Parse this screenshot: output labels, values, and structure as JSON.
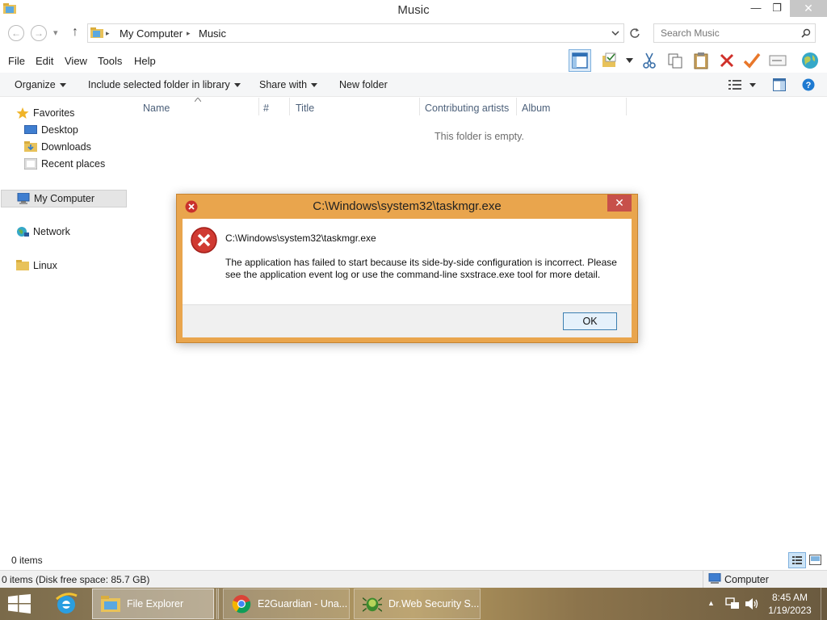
{
  "window": {
    "title": "Music",
    "minimize_glyph": "—",
    "restore_glyph": "❐",
    "close_glyph": "✕"
  },
  "navigation": {
    "back_glyph": "←",
    "forward_glyph": "→",
    "recent_glyph": "▾",
    "up_glyph": "↑"
  },
  "address": {
    "crumbs": [
      "My Computer",
      "Music"
    ],
    "separator": "▸"
  },
  "search": {
    "placeholder": "Search Music"
  },
  "menu": {
    "items": [
      "File",
      "Edit",
      "View",
      "Tools",
      "Help"
    ]
  },
  "toolbar_icons": [
    "layout-icon",
    "folder-check-icon",
    "cut-icon",
    "copy-icon",
    "paste-icon",
    "delete-icon",
    "checkmark-icon",
    "properties-icon",
    "globe-icon"
  ],
  "commandbar": {
    "organize": "Organize",
    "include_library": "Include selected folder in library",
    "share_with": "Share with",
    "new_folder": "New folder"
  },
  "navpane": {
    "favorites": "Favorites",
    "desktop": "Desktop",
    "downloads": "Downloads",
    "recent_places": "Recent places",
    "my_computer": "My Computer",
    "network": "Network",
    "linux": "Linux"
  },
  "columns": [
    "Name",
    "#",
    "Title",
    "Contributing artists",
    "Album"
  ],
  "content": {
    "empty_message": "This folder is empty."
  },
  "status": {
    "items": "0 items",
    "details": "0 items (Disk free space: 85.7 GB)",
    "location": "Computer"
  },
  "dialog": {
    "title": "C:\\Windows\\system32\\taskmgr.exe",
    "path": "C:\\Windows\\system32\\taskmgr.exe",
    "message": "The application has failed to start because its side-by-side configuration is incorrect. Please see the application event log or use the command-line sxstrace.exe tool for more detail.",
    "ok_label": "OK",
    "close_glyph": "✕"
  },
  "taskbar": {
    "file_explorer": "File Explorer",
    "chrome": "E2Guardian - Una...",
    "drweb": "Dr.Web Security S...",
    "time": "8:45 AM",
    "date": "1/19/2023",
    "tray_up_glyph": "▲"
  },
  "colors": {
    "dialog_frame": "#e9a54d",
    "error_red": "#c9302c",
    "link_blue": "#1e7ad1"
  }
}
